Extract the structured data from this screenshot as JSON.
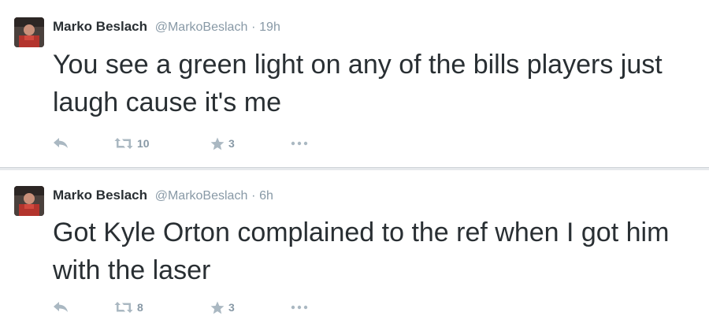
{
  "tweets": [
    {
      "fullname": "Marko Beslach",
      "handle": "@MarkoBeslach",
      "separator": "·",
      "time": "19h",
      "text": "You see a green light on any of the bills players just laugh cause it's me",
      "retweets": "10",
      "favorites": "3"
    },
    {
      "fullname": "Marko Beslach",
      "handle": "@MarkoBeslach",
      "separator": "·",
      "time": "6h",
      "text": "Got Kyle Orton complained to the ref when I got him with the laser",
      "retweets": "8",
      "favorites": "3"
    }
  ],
  "icons": {
    "reply": "reply-icon",
    "retweet": "retweet-icon",
    "favorite": "star-icon",
    "more": "ellipsis-icon"
  },
  "colors": {
    "text": "#292f33",
    "meta": "#8899a6",
    "icon": "#aab8c2",
    "divider": "#e6e9ec"
  }
}
